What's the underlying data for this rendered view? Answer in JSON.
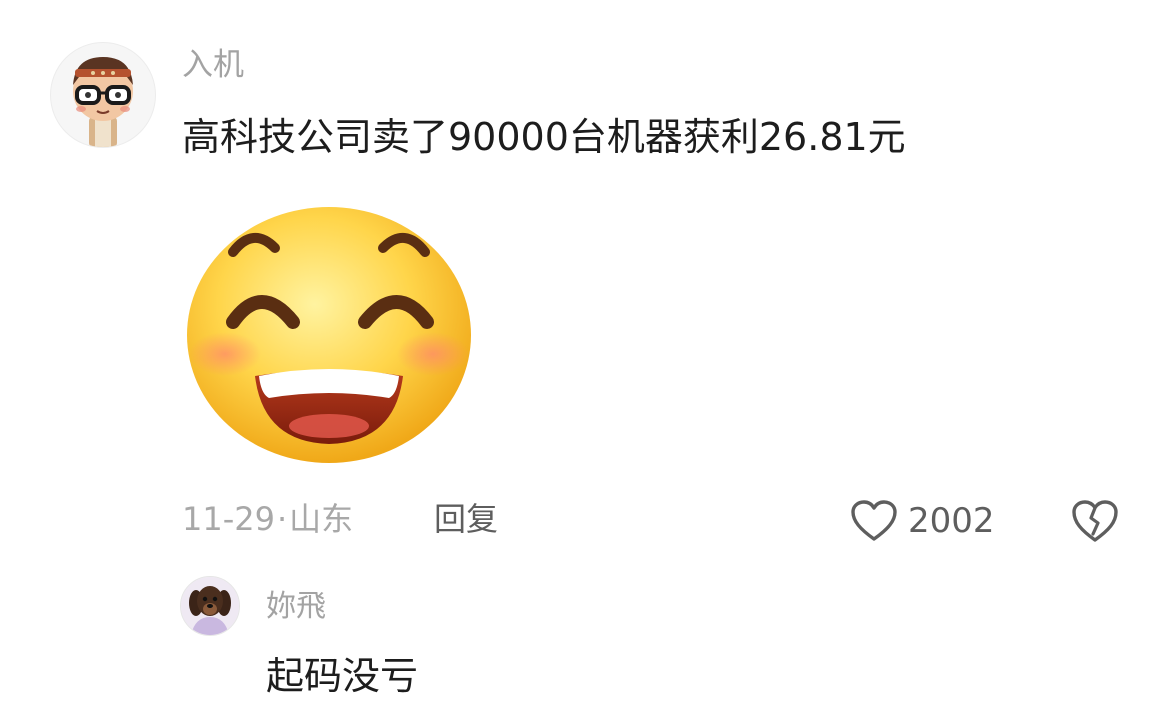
{
  "comment": {
    "username": "入机",
    "text": "高科技公司卖了90000台机器获利26.81元",
    "sticker": "grinning-face-emoji",
    "date": "11-29",
    "separator": "·",
    "location": "山东",
    "reply_label": "回复",
    "likes": "2002",
    "icons": {
      "like": "heart-outline-icon",
      "dislike": "broken-heart-icon"
    }
  },
  "reply": {
    "username": "妳飛",
    "text": "起码没亏"
  },
  "colors": {
    "username": "#a3a3a3",
    "text": "#1d1d1d",
    "meta": "#a8a8a8",
    "action": "#5e5e5e"
  }
}
